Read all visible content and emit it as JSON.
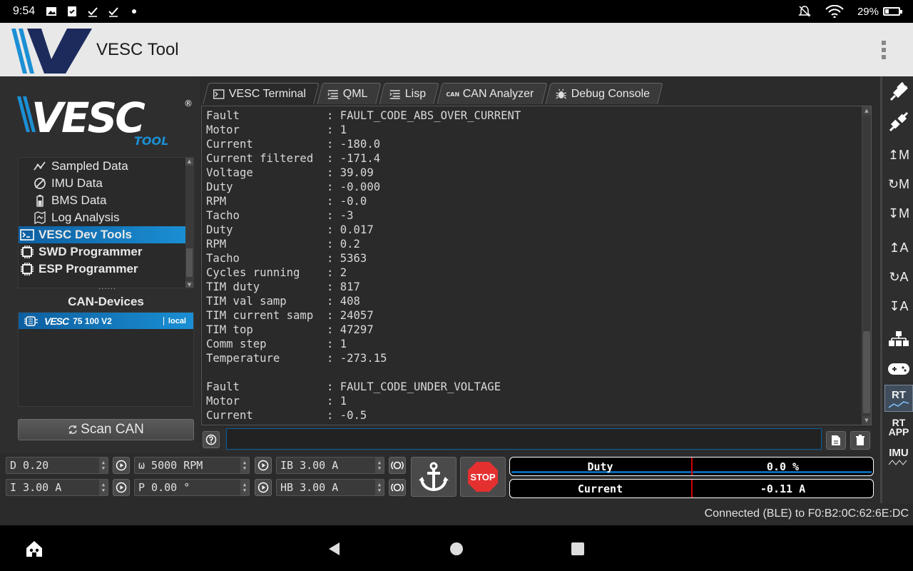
{
  "status_bar": {
    "time": "9:54",
    "battery": "29%",
    "battery_level": 0.29
  },
  "app_bar": {
    "title": "VESC Tool"
  },
  "brand": {
    "logo_text": "VESC",
    "logo_sub": "TOOL",
    "registered": "®"
  },
  "sidebar": {
    "items": [
      {
        "label": "Sampled Data",
        "icon": "sampled-data-icon"
      },
      {
        "label": "IMU Data",
        "icon": "imu-icon"
      },
      {
        "label": "BMS Data",
        "icon": "battery-icon"
      },
      {
        "label": "Log Analysis",
        "icon": "map-icon"
      },
      {
        "label": "VESC Dev Tools",
        "icon": "terminal-icon"
      },
      {
        "label": "SWD Programmer",
        "icon": "chip-icon"
      },
      {
        "label": "ESP Programmer",
        "icon": "chip-icon"
      }
    ],
    "dots": "......"
  },
  "can": {
    "title": "CAN-Devices",
    "devices": [
      {
        "logo": "VESC",
        "name": "75 100 V2",
        "badge": "local"
      }
    ],
    "scan_label": "Scan CAN"
  },
  "tabs": [
    {
      "label": "VESC Terminal",
      "icon": "terminal-icon"
    },
    {
      "label": "QML",
      "icon": "script-icon"
    },
    {
      "label": "Lisp",
      "icon": "script-icon"
    },
    {
      "label": "CAN Analyzer",
      "icon": "can-icon",
      "icon_text": "CAN"
    },
    {
      "label": "Debug Console",
      "icon": "bug-icon"
    }
  ],
  "terminal": {
    "lines": [
      "Fault             : FAULT_CODE_ABS_OVER_CURRENT",
      "Motor             : 1",
      "Current           : -180.0",
      "Current filtered  : -171.4",
      "Voltage           : 39.09",
      "Duty              : -0.000",
      "RPM               : -0.0",
      "Tacho             : -3",
      "Duty              : 0.017",
      "RPM               : 0.2",
      "Tacho             : 5363",
      "Cycles running    : 2",
      "TIM duty          : 817",
      "TIM val samp      : 408",
      "TIM current samp  : 24057",
      "TIM top           : 47297",
      "Comm step         : 1",
      "Temperature       : -273.15",
      "",
      "Fault             : FAULT_CODE_UNDER_VOLTAGE",
      "Motor             : 1",
      "Current           : -0.5"
    ],
    "input_value": ""
  },
  "right_toolbar": [
    {
      "name": "connect-icon"
    },
    {
      "name": "disconnect-icon"
    },
    {
      "label": "↥M",
      "name": "read-motor-config"
    },
    {
      "label": "↻M",
      "name": "read-default-motor-config"
    },
    {
      "label": "↧M",
      "name": "write-motor-config"
    },
    {
      "label": "↥A",
      "name": "read-app-config"
    },
    {
      "label": "↻A",
      "name": "read-default-app-config"
    },
    {
      "label": "↧A",
      "name": "write-app-config"
    },
    {
      "name": "can-fwd-icon"
    },
    {
      "name": "gamepad-icon"
    },
    {
      "label": "RT",
      "name": "rt-data"
    },
    {
      "label": "RT APP",
      "name": "rt-app-data"
    },
    {
      "label": "IMU",
      "name": "imu-data"
    }
  ],
  "controls": {
    "duty": "D 0.20",
    "current": "I 3.00 A",
    "rpm": "ω 5000 RPM",
    "position": "P 0.00 °",
    "brake_current": "IB 3.00 A",
    "handbrake_current": "HB 3.00 A",
    "stop_label": "STOP"
  },
  "gauges": {
    "duty": {
      "label": "Duty",
      "value": "0.0 %",
      "fraction": 0.0
    },
    "current": {
      "label": "Current",
      "value": "-0.11 A",
      "fraction": -0.001
    }
  },
  "connection": "Connected (BLE) to F0:B2:0C:62:6E:DC",
  "colors": {
    "accent": "#1b8fd4",
    "stop": "#e53030",
    "gauge_bar": "#0a66b0"
  }
}
